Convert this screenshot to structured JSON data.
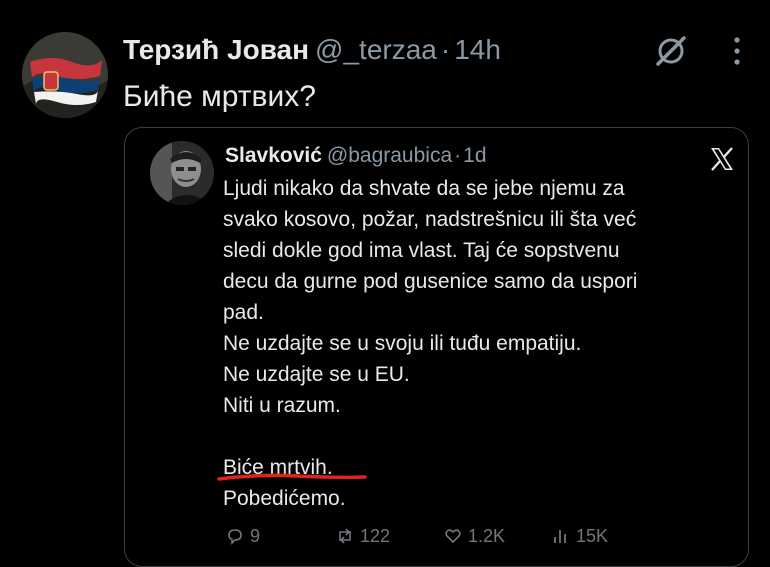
{
  "tweet": {
    "author_name": "Терзић Јован",
    "author_handle": "@_terzaa",
    "separator": "·",
    "time": "14h",
    "text": "Биће мртвих?",
    "icons": [
      "grok-icon",
      "more-icon"
    ]
  },
  "quoted_tweet": {
    "author_name": "Slavković",
    "author_handle": "@bagraubica",
    "separator": "·",
    "time": "1d",
    "lines": [
      "Ljudi nikako da shvate da se jebe njemu za",
      "svako kosovo, požar, nadstrešnicu ili šta već",
      "sledi dokle god ima vlast. Taj će sopstvenu",
      "decu da gurne pod gusenice samo da uspori",
      "pad.",
      "Ne uzdajte se u svoju ili tuđu empatiju.",
      "Ne uzdajte se u EU.",
      "Niti u razum."
    ],
    "underlined_line": "Biće mrtvih.",
    "last_line": "Pobedićemo.",
    "source_logo": "x-logo",
    "underline_color": "#e0231b"
  },
  "actions": {
    "replies": "9",
    "reposts": "122",
    "likes": "1.2K",
    "views": "15K"
  }
}
